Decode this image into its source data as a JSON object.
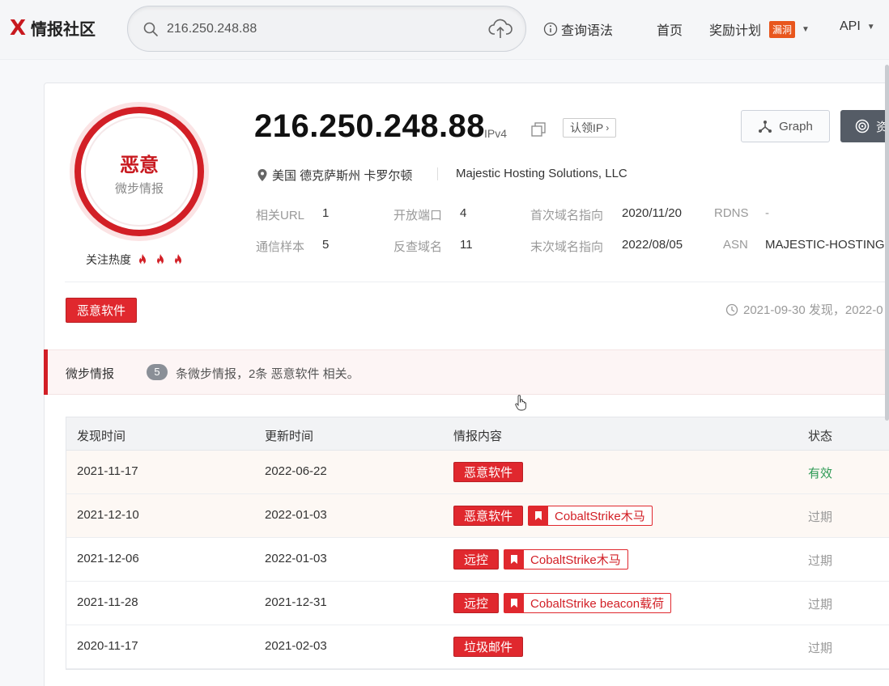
{
  "app": {
    "logo_mark": "X",
    "logo_text": "情报社区"
  },
  "search": {
    "value": "216.250.248.88"
  },
  "nav": {
    "syntax": "查询语法",
    "home": "首页",
    "rewards": "奖励计划",
    "rewards_badge": "漏洞",
    "api": "API"
  },
  "verdict": {
    "label": "恶意",
    "sub": "微步情报",
    "heat_label": "关注热度"
  },
  "ip": {
    "address": "216.250.248.88",
    "version": "IPv4",
    "claim": "认领IP",
    "location": "美国 德克萨斯州 卡罗尔顿",
    "org": "Majestic Hosting Solutions, LLC"
  },
  "buttons": {
    "graph": "Graph",
    "dark": "资"
  },
  "stats": {
    "related_url_k": "相关URL",
    "related_url_v": "1",
    "open_ports_k": "开放端口",
    "open_ports_v": "4",
    "first_domain_k": "首次域名指向",
    "first_domain_v": "2020/11/20",
    "rdns_k": "RDNS",
    "rdns_v": "-",
    "samples_k": "通信样本",
    "samples_v": "5",
    "reverse_k": "反查域名",
    "reverse_v": "11",
    "last_domain_k": "末次域名指向",
    "last_domain_v": "2022/08/05",
    "asn_k": "ASN",
    "asn_v": "MAJESTIC-HOSTING"
  },
  "tag": "恶意软件",
  "time_info": "2021-09-30 发现，2022-0",
  "intel": {
    "title": "微步情报",
    "count": "5",
    "desc": "条微步情报，2条 恶意软件 相关。"
  },
  "table": {
    "headers": {
      "found": "发现时间",
      "updated": "更新时间",
      "content": "情报内容",
      "status": "状态"
    },
    "rows": [
      {
        "found": "2021-11-17",
        "updated": "2022-06-22",
        "tag": "恶意软件",
        "extra": "",
        "status": "有效"
      },
      {
        "found": "2021-12-10",
        "updated": "2022-01-03",
        "tag": "恶意软件",
        "extra": "CobaltStrike木马",
        "status": "过期"
      },
      {
        "found": "2021-12-06",
        "updated": "2022-01-03",
        "tag": "远控",
        "extra": "CobaltStrike木马",
        "status": "过期"
      },
      {
        "found": "2021-11-28",
        "updated": "2021-12-31",
        "tag": "远控",
        "extra": "CobaltStrike beacon载荷",
        "status": "过期"
      },
      {
        "found": "2020-11-17",
        "updated": "2021-02-03",
        "tag": "垃圾邮件",
        "extra": "",
        "status": "过期"
      }
    ]
  },
  "colors": {
    "brand": "#d21f26",
    "valid": "#2e9a55",
    "expired": "#999999"
  }
}
